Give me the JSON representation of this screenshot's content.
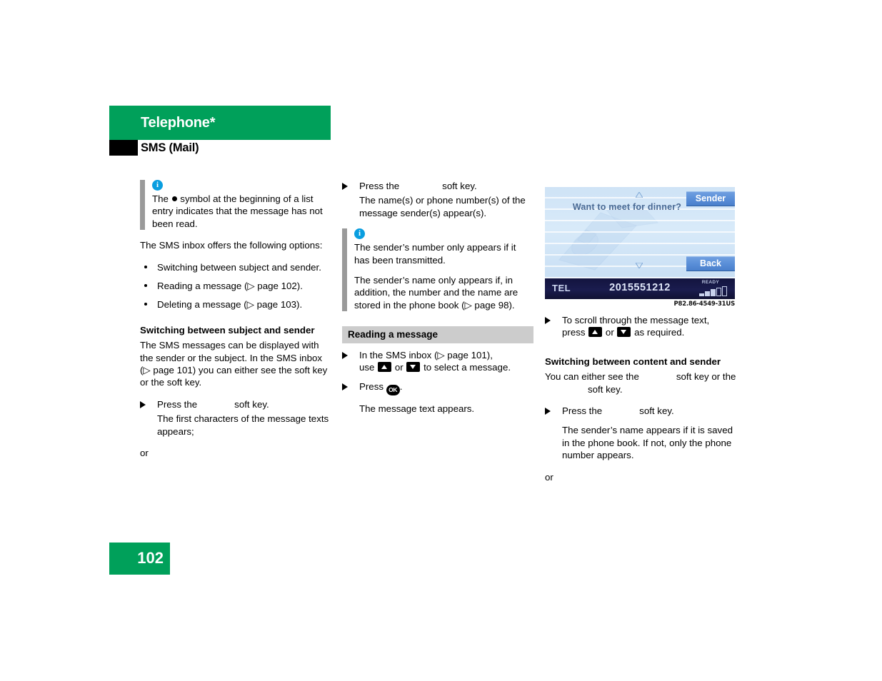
{
  "header": {
    "title": "Telephone*",
    "subtitle": "SMS (Mail)"
  },
  "page_number": "102",
  "figure": {
    "caption": "P82.86-4549-31US",
    "screen": {
      "message_text": "Want to meet for dinner?",
      "softkey_top": "Sender",
      "softkey_bottom": "Back",
      "status_mode": "TEL",
      "status_number": "2015551212",
      "status_ready": "READY"
    }
  },
  "column1": {
    "note1": {
      "icon": "info-icon",
      "text_before_dot": "The ",
      "text_after_dot": " symbol at the beginning of a list entry indicates that the message has not been read."
    },
    "intro": "The SMS inbox offers the following options:",
    "bullets": [
      "Switching between subject and sender.",
      "Reading a message (▷ page 102).",
      "Deleting a message (▷ page 103)."
    ],
    "subhead": "Switching between subject and sender",
    "body": "The SMS messages can be displayed with the sender or the subject. In the SMS inbox (▷ page 101) you can either see the          soft key or the          soft key.",
    "step1_pre": "Press the",
    "step1_post": "soft key.",
    "step1_result": "The first characters of the message texts appears;",
    "or": "or"
  },
  "column2": {
    "step1_pre": "Press the",
    "step1_post": "soft key.",
    "step1_result": "The name(s) or phone number(s) of the message sender(s) appear(s).",
    "note1": {
      "icon": "info-icon",
      "p1": "The sender’s number only appears if it has been transmitted.",
      "p2": "The sender’s name only appears if, in addition, the number and the name are stored in the phone book (▷ page 98)."
    },
    "banner": "Reading a message",
    "step2_line1": "In the SMS inbox (▷ page 101),",
    "step2_line2_pre": "use",
    "step2_line2_mid": "or",
    "step2_line2_post": "to select a message.",
    "step3_pre": "Press",
    "step3_post": ".",
    "step3_result": "The message text appears."
  },
  "column3": {
    "step1_line1": "To scroll through the message text,",
    "step1_line2_pre": "press",
    "step1_line2_mid": "or",
    "step1_line2_post": "as required.",
    "subhead": "Switching between content and sender",
    "body_pre": "You can either see the",
    "body_mid": "soft key or the",
    "body_post": "soft key.",
    "step2_pre": "Press the",
    "step2_post": "soft key.",
    "step2_result": "The sender’s name appears if it is saved in the phone book. If not, only the phone number appears.",
    "or": "or"
  },
  "colors": {
    "brand_green": "#00a05a",
    "info_blue": "#0a9ee0",
    "banner_gray": "#cccccc",
    "note_bar_gray": "#9a9a9a",
    "softkey_blue": "#5a8fd8",
    "status_navy": "#1a1c4e"
  }
}
